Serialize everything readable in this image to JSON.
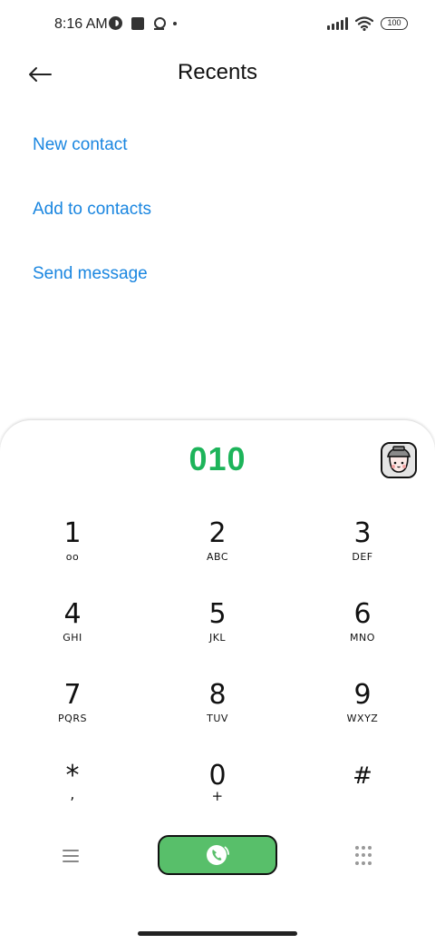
{
  "status_bar": {
    "time": "8:16 AM",
    "battery": "100",
    "icons": [
      "data-saver-icon",
      "square-icon",
      "location-icon",
      "dot-icon",
      "signal-icon",
      "wifi-icon",
      "battery-icon"
    ]
  },
  "header": {
    "title": "Recents",
    "back_icon": "arrow-left-icon"
  },
  "actions": [
    {
      "label": "New contact"
    },
    {
      "label": "Add to contacts"
    },
    {
      "label": "Send message"
    }
  ],
  "dialer": {
    "number": "010",
    "number_color": "#1db45a",
    "keys": [
      {
        "digit": "1",
        "letters": "oo"
      },
      {
        "digit": "2",
        "letters": "ABC"
      },
      {
        "digit": "3",
        "letters": "DEF"
      },
      {
        "digit": "4",
        "letters": "GHI"
      },
      {
        "digit": "5",
        "letters": "JKL"
      },
      {
        "digit": "6",
        "letters": "MNO"
      },
      {
        "digit": "7",
        "letters": "PQRS"
      },
      {
        "digit": "8",
        "letters": "TUV"
      },
      {
        "digit": "9",
        "letters": "WXYZ"
      },
      {
        "digit": "*",
        "letters": ","
      },
      {
        "digit": "0",
        "letters": "+"
      },
      {
        "digit": "#",
        "letters": ""
      }
    ],
    "call_button_color": "#58bf6a",
    "bottom_icons": [
      "menu-icon",
      "phone-call-icon",
      "dialpad-icon"
    ]
  },
  "colors": {
    "accent": "#1a86e0",
    "call_green": "#58bf6a"
  }
}
